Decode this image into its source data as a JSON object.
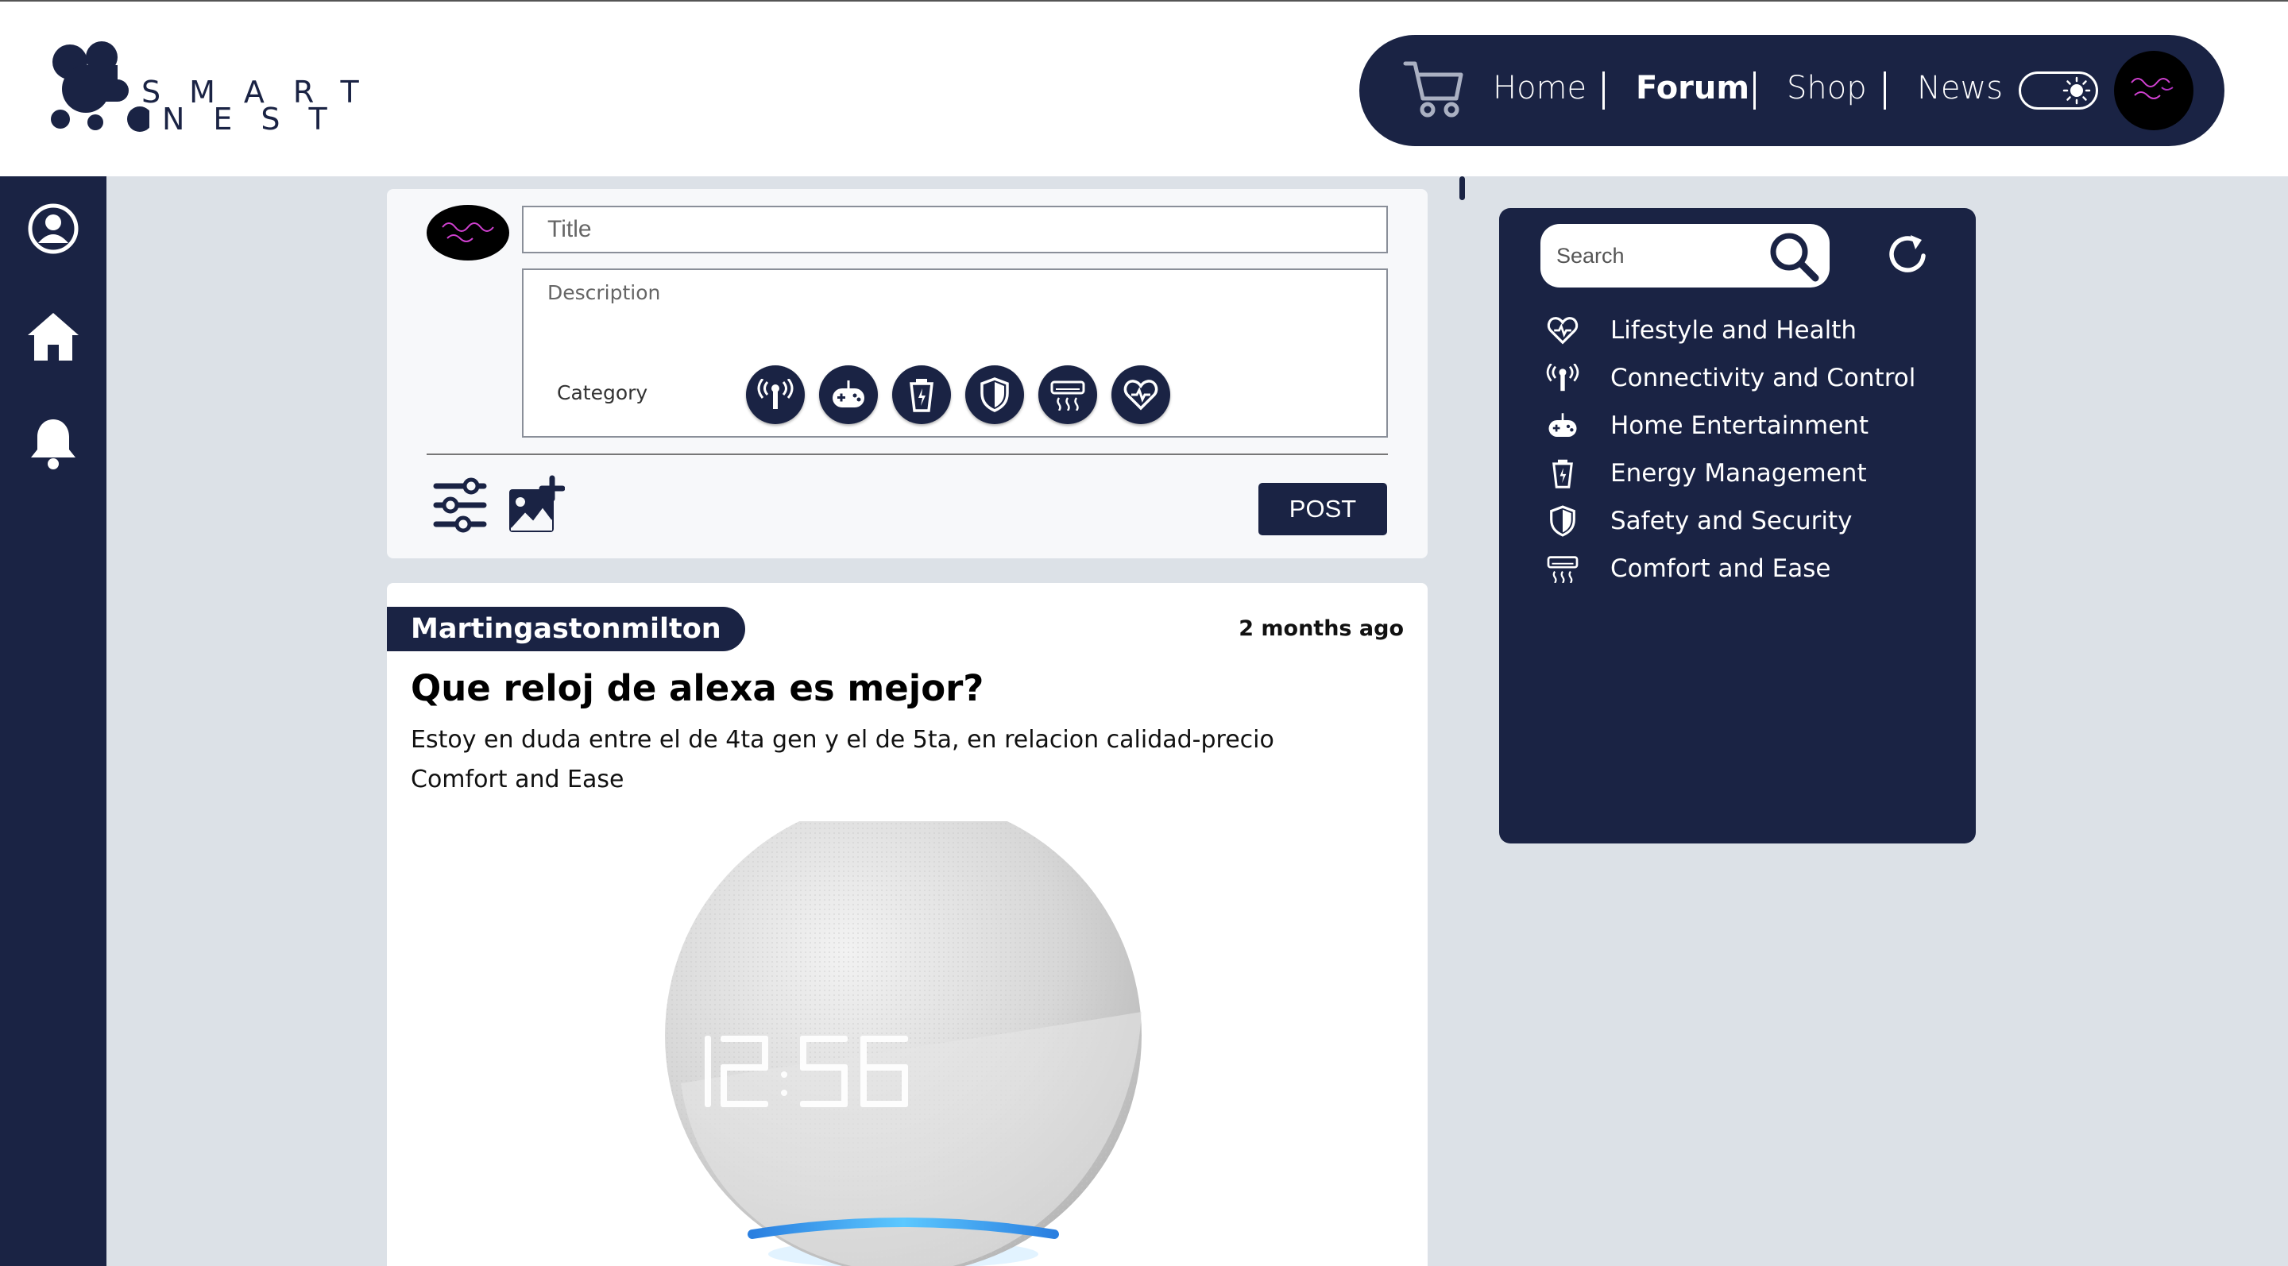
{
  "brand": {
    "logo_line1": "SMART",
    "logo_line2": "NEST"
  },
  "nav": {
    "items": [
      {
        "label": "Home",
        "active": false
      },
      {
        "label": "Forum",
        "active": true
      },
      {
        "label": "Shop",
        "active": false
      },
      {
        "label": "News",
        "active": false
      }
    ],
    "icons": {
      "cart": "cart-icon",
      "theme": "sun-icon",
      "avatar": "user-avatar"
    }
  },
  "left_rail": {
    "icons": [
      "user-circle-icon",
      "home-icon",
      "bell-icon"
    ]
  },
  "composer": {
    "title_placeholder": "Title",
    "description_placeholder": "Description",
    "category_label": "Category",
    "category_icons": [
      "antenna-icon",
      "gamepad-icon",
      "battery-cup-icon",
      "shield-icon",
      "air-conditioner-icon",
      "heart-pulse-icon"
    ],
    "tools": [
      "sliders-icon",
      "add-image-icon"
    ],
    "post_label": "POST"
  },
  "post": {
    "author": "Martingastonmilton",
    "time": "2 months ago",
    "title": "Que reloj de alexa es mejor?",
    "body": "Estoy en duda entre el de 4ta gen y el de 5ta, en relacion calidad-precio",
    "category": "Comfort and Ease",
    "image": "smart-speaker-image"
  },
  "side_panel": {
    "search_placeholder": "Search",
    "categories": [
      {
        "label": "Lifestyle and Health",
        "icon": "heart-pulse-icon"
      },
      {
        "label": "Connectivity and Control",
        "icon": "antenna-icon"
      },
      {
        "label": "Home Entertainment",
        "icon": "gamepad-icon"
      },
      {
        "label": "Energy Management",
        "icon": "battery-cup-icon"
      },
      {
        "label": "Safety and Security",
        "icon": "shield-icon"
      },
      {
        "label": "Comfort and Ease",
        "icon": "air-conditioner-icon"
      }
    ]
  },
  "colors": {
    "navy": "#1a2344",
    "background": "#dce1e7",
    "card": "#ffffff",
    "accent_blue": "#3aa0ff"
  }
}
